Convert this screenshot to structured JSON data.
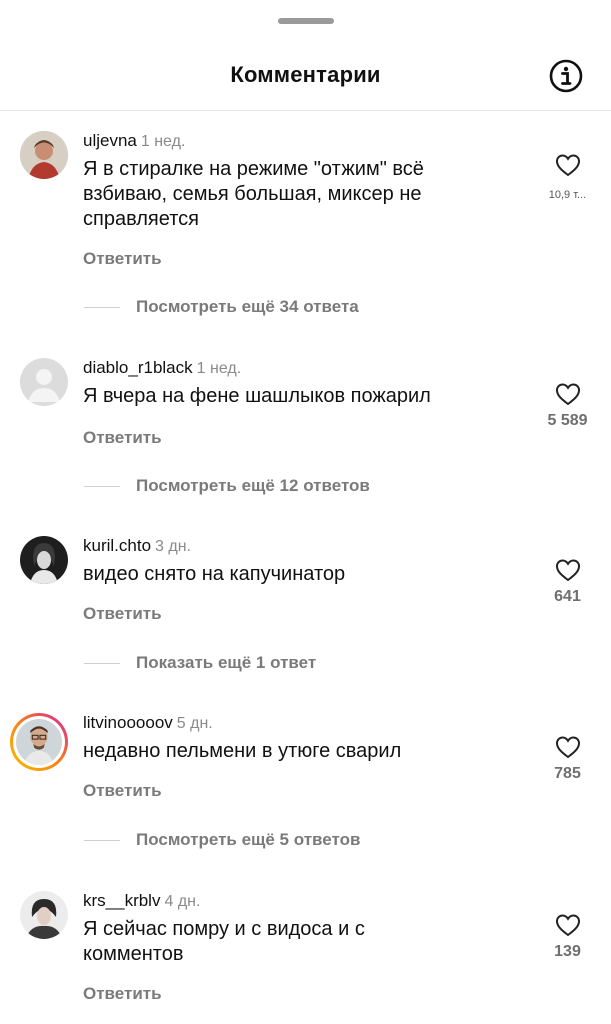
{
  "header": {
    "title": "Комментарии",
    "info_icon": "info-icon"
  },
  "reply_label": "Ответить",
  "comments": [
    {
      "username": "uljevna",
      "time": "1 нед.",
      "text": "Я в стиралке на режиме \"отжим\" всё взбиваю, семья большая, миксер не справляется",
      "likes": "10,9 т...",
      "more_replies": "Посмотреть ещё 34 ответа"
    },
    {
      "username": "diablo_r1black",
      "time": "1 нед.",
      "text": "Я вчера на фене шашлыков пожарил",
      "likes": "5 589",
      "more_replies": "Посмотреть ещё 12 ответов"
    },
    {
      "username": "kuril.chto",
      "time": "3 дн.",
      "text": "видео снято на капучинатор",
      "likes": "641",
      "more_replies": "Показать ещё 1 ответ"
    },
    {
      "username": "litvinooooov",
      "time": "5 дн.",
      "text": "недавно пельмени в утюге сварил",
      "likes": "785",
      "more_replies": "Посмотреть ещё 5 ответов"
    },
    {
      "username": "krs__krblv",
      "time": "4 дн.",
      "text": "Я сейчас помру и с видоса и с комментов",
      "likes": "139"
    }
  ],
  "colors": {
    "text": "#111111",
    "muted": "#7a7a7a",
    "story_ring_start": "#f9c200",
    "story_ring_end": "#d6249f"
  }
}
